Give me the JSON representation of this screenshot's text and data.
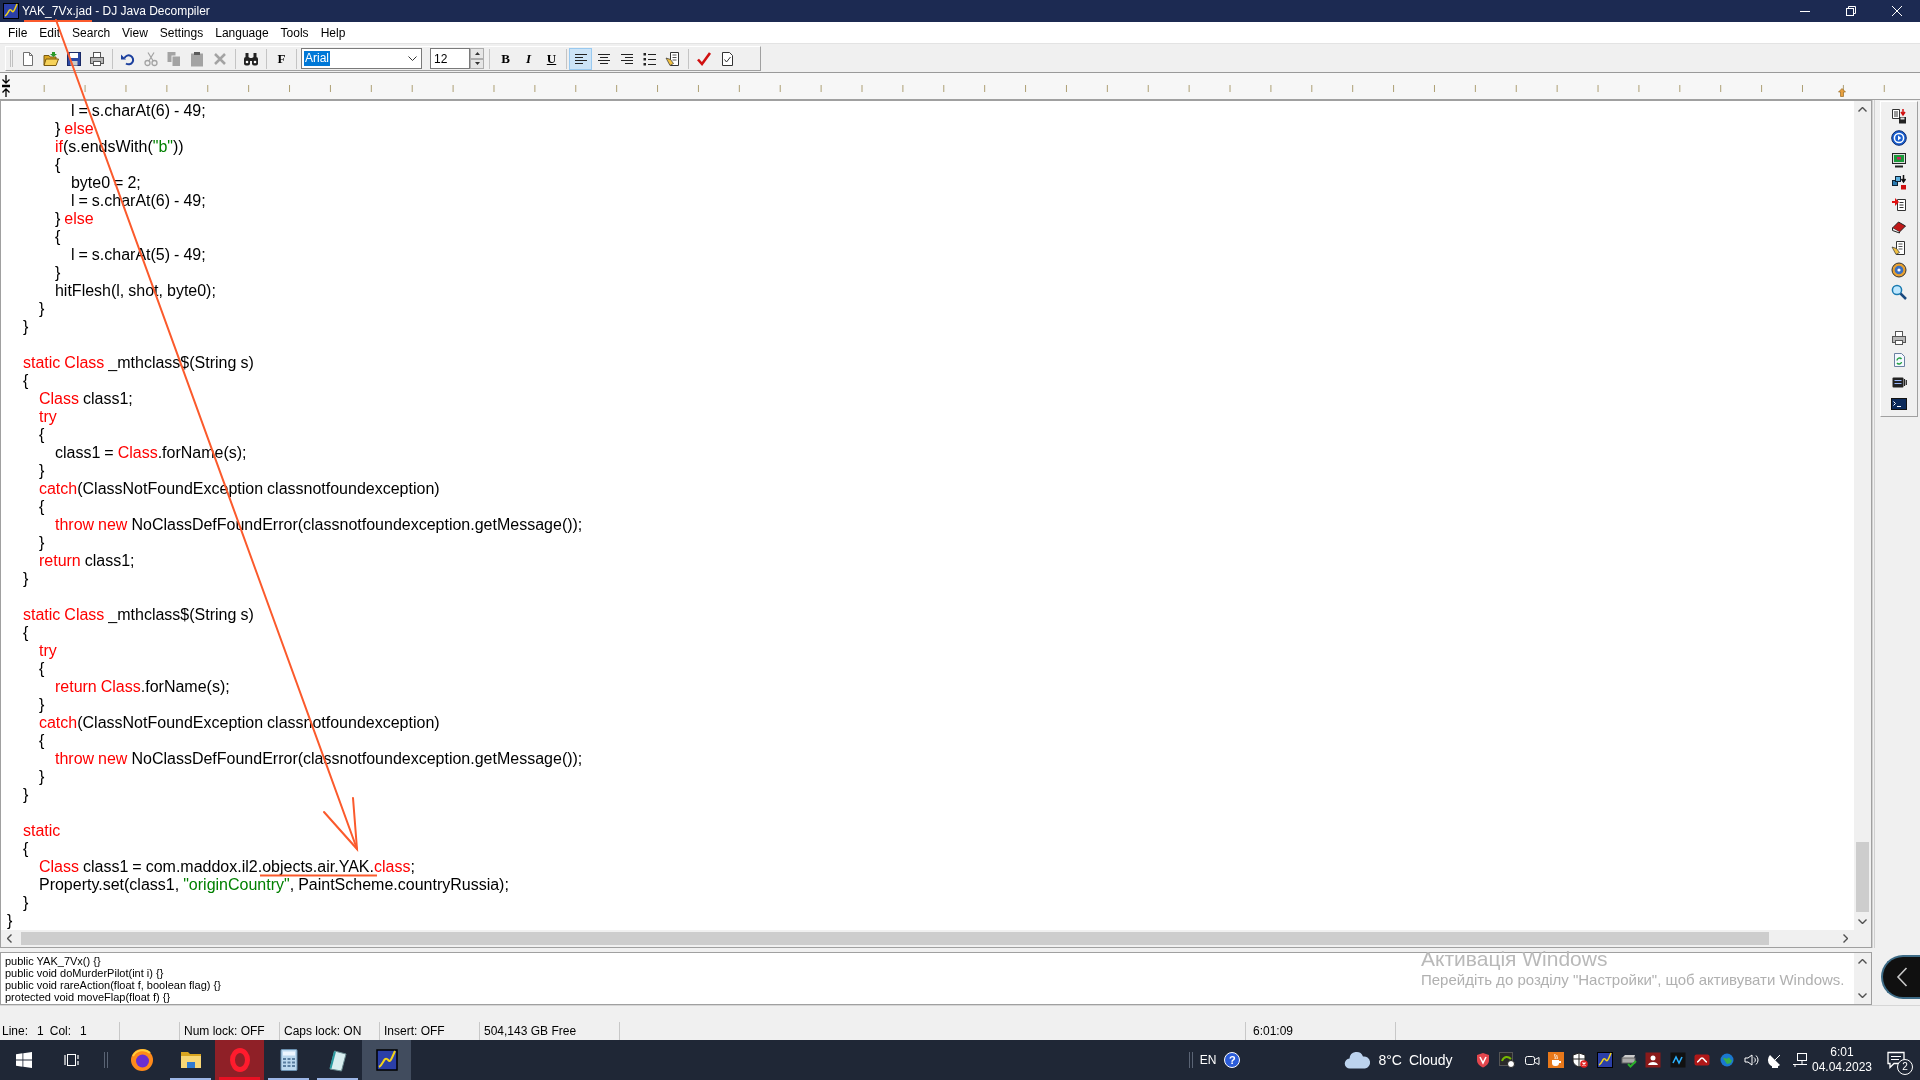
{
  "window": {
    "title": "YAK_7Vx.jad - DJ Java Decompiler"
  },
  "menu": [
    "File",
    "Edit",
    "Search",
    "View",
    "Settings",
    "Language",
    "Tools",
    "Help"
  ],
  "toolbar": {
    "edit_actions": [
      {
        "disabled": true
      },
      {
        "disabled": true
      },
      {
        "disabled": true
      },
      {
        "disabled": true
      }
    ],
    "format_label": "F",
    "font": {
      "value": "Arial",
      "highlighted": true
    },
    "font_size": {
      "value": "12"
    },
    "styles": [
      "B",
      "I",
      "U"
    ],
    "alignment": [
      {
        "selected": true
      },
      {
        "selected": false
      },
      {
        "selected": false
      }
    ]
  },
  "editor": {
    "lines": [
      {
        "kind": "code",
        "tokens": [
          {
            "kind": "plain",
            "text": "                l = s.charAt(6) - 49;"
          }
        ]
      },
      {
        "kind": "code",
        "tokens": [
          {
            "kind": "plain",
            "text": "            }"
          },
          {
            "kind": "keyword",
            "text": " else"
          }
        ]
      },
      {
        "kind": "code",
        "tokens": [
          {
            "kind": "keyword",
            "text": "            if"
          },
          {
            "kind": "plain",
            "text": "(s.endsWith("
          },
          {
            "kind": "string",
            "text": "\"b\""
          },
          {
            "kind": "plain",
            "text": "))"
          }
        ]
      },
      {
        "kind": "code",
        "tokens": [
          {
            "kind": "plain",
            "text": "            {"
          }
        ]
      },
      {
        "kind": "code",
        "tokens": [
          {
            "kind": "plain",
            "text": "                byte0 = 2;"
          }
        ]
      },
      {
        "kind": "code",
        "tokens": [
          {
            "kind": "plain",
            "text": "                l = s.charAt(6) - 49;"
          }
        ]
      },
      {
        "kind": "code",
        "tokens": [
          {
            "kind": "plain",
            "text": "            }"
          },
          {
            "kind": "keyword",
            "text": " else"
          }
        ]
      },
      {
        "kind": "code",
        "tokens": [
          {
            "kind": "plain",
            "text": "            {"
          }
        ]
      },
      {
        "kind": "code",
        "tokens": [
          {
            "kind": "plain",
            "text": "                l = s.charAt(5) - 49;"
          }
        ]
      },
      {
        "kind": "code",
        "tokens": [
          {
            "kind": "plain",
            "text": "            }"
          }
        ]
      },
      {
        "kind": "code",
        "tokens": [
          {
            "kind": "plain",
            "text": "            hitFlesh(l, shot, byte0);"
          }
        ]
      },
      {
        "kind": "code",
        "tokens": [
          {
            "kind": "plain",
            "text": "        }"
          }
        ]
      },
      {
        "kind": "code",
        "tokens": [
          {
            "kind": "plain",
            "text": "    }"
          }
        ]
      },
      {
        "kind": "blank"
      },
      {
        "kind": "code",
        "tokens": [
          {
            "kind": "keyword",
            "text": "    static Class"
          },
          {
            "kind": "plain",
            "text": " _mthclass$(String s)"
          }
        ]
      },
      {
        "kind": "code",
        "tokens": [
          {
            "kind": "plain",
            "text": "    {"
          }
        ]
      },
      {
        "kind": "code",
        "tokens": [
          {
            "kind": "keyword",
            "text": "        Class"
          },
          {
            "kind": "plain",
            "text": " class1;"
          }
        ]
      },
      {
        "kind": "code",
        "tokens": [
          {
            "kind": "keyword",
            "text": "        try"
          }
        ]
      },
      {
        "kind": "code",
        "tokens": [
          {
            "kind": "plain",
            "text": "        {"
          }
        ]
      },
      {
        "kind": "code",
        "tokens": [
          {
            "kind": "plain",
            "text": "            class1 = "
          },
          {
            "kind": "keyword",
            "text": "Class"
          },
          {
            "kind": "plain",
            "text": ".forName(s);"
          }
        ]
      },
      {
        "kind": "code",
        "tokens": [
          {
            "kind": "plain",
            "text": "        }"
          }
        ]
      },
      {
        "kind": "code",
        "tokens": [
          {
            "kind": "keyword",
            "text": "        catch"
          },
          {
            "kind": "plain",
            "text": "(ClassNotFoundException classnotfoundexception)"
          }
        ]
      },
      {
        "kind": "code",
        "tokens": [
          {
            "kind": "plain",
            "text": "        {"
          }
        ]
      },
      {
        "kind": "code",
        "tokens": [
          {
            "kind": "keyword",
            "text": "            throw new"
          },
          {
            "kind": "plain",
            "text": " NoClassDefFoundError(classnotfoundexception.getMessage());"
          }
        ]
      },
      {
        "kind": "code",
        "tokens": [
          {
            "kind": "plain",
            "text": "        }"
          }
        ]
      },
      {
        "kind": "code",
        "tokens": [
          {
            "kind": "keyword",
            "text": "        return"
          },
          {
            "kind": "plain",
            "text": " class1;"
          }
        ]
      },
      {
        "kind": "code",
        "tokens": [
          {
            "kind": "plain",
            "text": "    }"
          }
        ]
      },
      {
        "kind": "blank"
      },
      {
        "kind": "code",
        "tokens": [
          {
            "kind": "keyword",
            "text": "    static Class"
          },
          {
            "kind": "plain",
            "text": " _mthclass$(String s)"
          }
        ]
      },
      {
        "kind": "code",
        "tokens": [
          {
            "kind": "plain",
            "text": "    {"
          }
        ]
      },
      {
        "kind": "code",
        "tokens": [
          {
            "kind": "keyword",
            "text": "        try"
          }
        ]
      },
      {
        "kind": "code",
        "tokens": [
          {
            "kind": "plain",
            "text": "        {"
          }
        ]
      },
      {
        "kind": "code",
        "tokens": [
          {
            "kind": "keyword",
            "text": "            return Class"
          },
          {
            "kind": "plain",
            "text": ".forName(s);"
          }
        ]
      },
      {
        "kind": "code",
        "tokens": [
          {
            "kind": "plain",
            "text": "        }"
          }
        ]
      },
      {
        "kind": "code",
        "tokens": [
          {
            "kind": "keyword",
            "text": "        catch"
          },
          {
            "kind": "plain",
            "text": "(ClassNotFoundException classnotfoundexception)"
          }
        ]
      },
      {
        "kind": "code",
        "tokens": [
          {
            "kind": "plain",
            "text": "        {"
          }
        ]
      },
      {
        "kind": "code",
        "tokens": [
          {
            "kind": "keyword",
            "text": "            throw new"
          },
          {
            "kind": "plain",
            "text": " NoClassDefFoundError(classnotfoundexception.getMessage());"
          }
        ]
      },
      {
        "kind": "code",
        "tokens": [
          {
            "kind": "plain",
            "text": "        }"
          }
        ]
      },
      {
        "kind": "code",
        "tokens": [
          {
            "kind": "plain",
            "text": "    }"
          }
        ]
      },
      {
        "kind": "blank"
      },
      {
        "kind": "code",
        "tokens": [
          {
            "kind": "keyword",
            "text": "    static"
          }
        ]
      },
      {
        "kind": "code",
        "tokens": [
          {
            "kind": "plain",
            "text": "    {"
          }
        ]
      },
      {
        "kind": "code",
        "tokens": [
          {
            "kind": "keyword",
            "text": "        Class"
          },
          {
            "kind": "plain",
            "text": " class1 = com.maddox.il2.objects.air.YAK."
          },
          {
            "kind": "keyword",
            "text": "class"
          },
          {
            "kind": "plain",
            "text": ";"
          }
        ]
      },
      {
        "kind": "code",
        "tokens": [
          {
            "kind": "plain",
            "text": "        Property.set(class1, "
          },
          {
            "kind": "string",
            "text": "\"originCountry\""
          },
          {
            "kind": "plain",
            "text": ", PaintScheme.countryRussia);"
          }
        ]
      },
      {
        "kind": "code",
        "tokens": [
          {
            "kind": "plain",
            "text": "    }"
          }
        ]
      },
      {
        "kind": "code",
        "tokens": [
          {
            "kind": "plain",
            "text": "}"
          }
        ]
      }
    ]
  },
  "members_panel": {
    "lines": [
      "public YAK_7Vx() {}",
      "public void doMurderPilot(int i) {}",
      "public void rareAction(float f, boolean flag) {}",
      "protected void moveFlap(float f) {}"
    ]
  },
  "activation_notice": {
    "title": "Активація Windows",
    "text": "Перейдіть до розділу \"Настройки\", щоб активувати Windows."
  },
  "status_bar": {
    "position": [
      {
        "label": "Line:",
        "value": "1"
      },
      {
        "label": "Col:",
        "value": "1"
      }
    ],
    "panels": [
      "Num lock: OFF",
      "Caps lock: ON",
      "Insert: OFF",
      "504,143 GB Free"
    ],
    "time": "6:01:09"
  },
  "annotations": [
    {
      "kind": "underline"
    },
    {
      "kind": "arrow"
    },
    {
      "kind": "underline"
    }
  ],
  "taskbar": {
    "apps": [
      {
        "running": false,
        "selected": false,
        "attention": false
      },
      {
        "running": true,
        "selected": false,
        "attention": false
      },
      {
        "running": true,
        "selected": false,
        "attention": true
      },
      {
        "running": true,
        "selected": false,
        "attention": false
      },
      {
        "running": true,
        "selected": false,
        "attention": false
      },
      {
        "running": false,
        "selected": true,
        "attention": false
      }
    ],
    "language": "EN",
    "help_label": "?",
    "weather": {
      "temperature": "8°C",
      "condition": "Cloudy"
    },
    "clock": {
      "time": "6:01",
      "date": "04.04.2023"
    },
    "notifications": {
      "count": "2"
    }
  }
}
